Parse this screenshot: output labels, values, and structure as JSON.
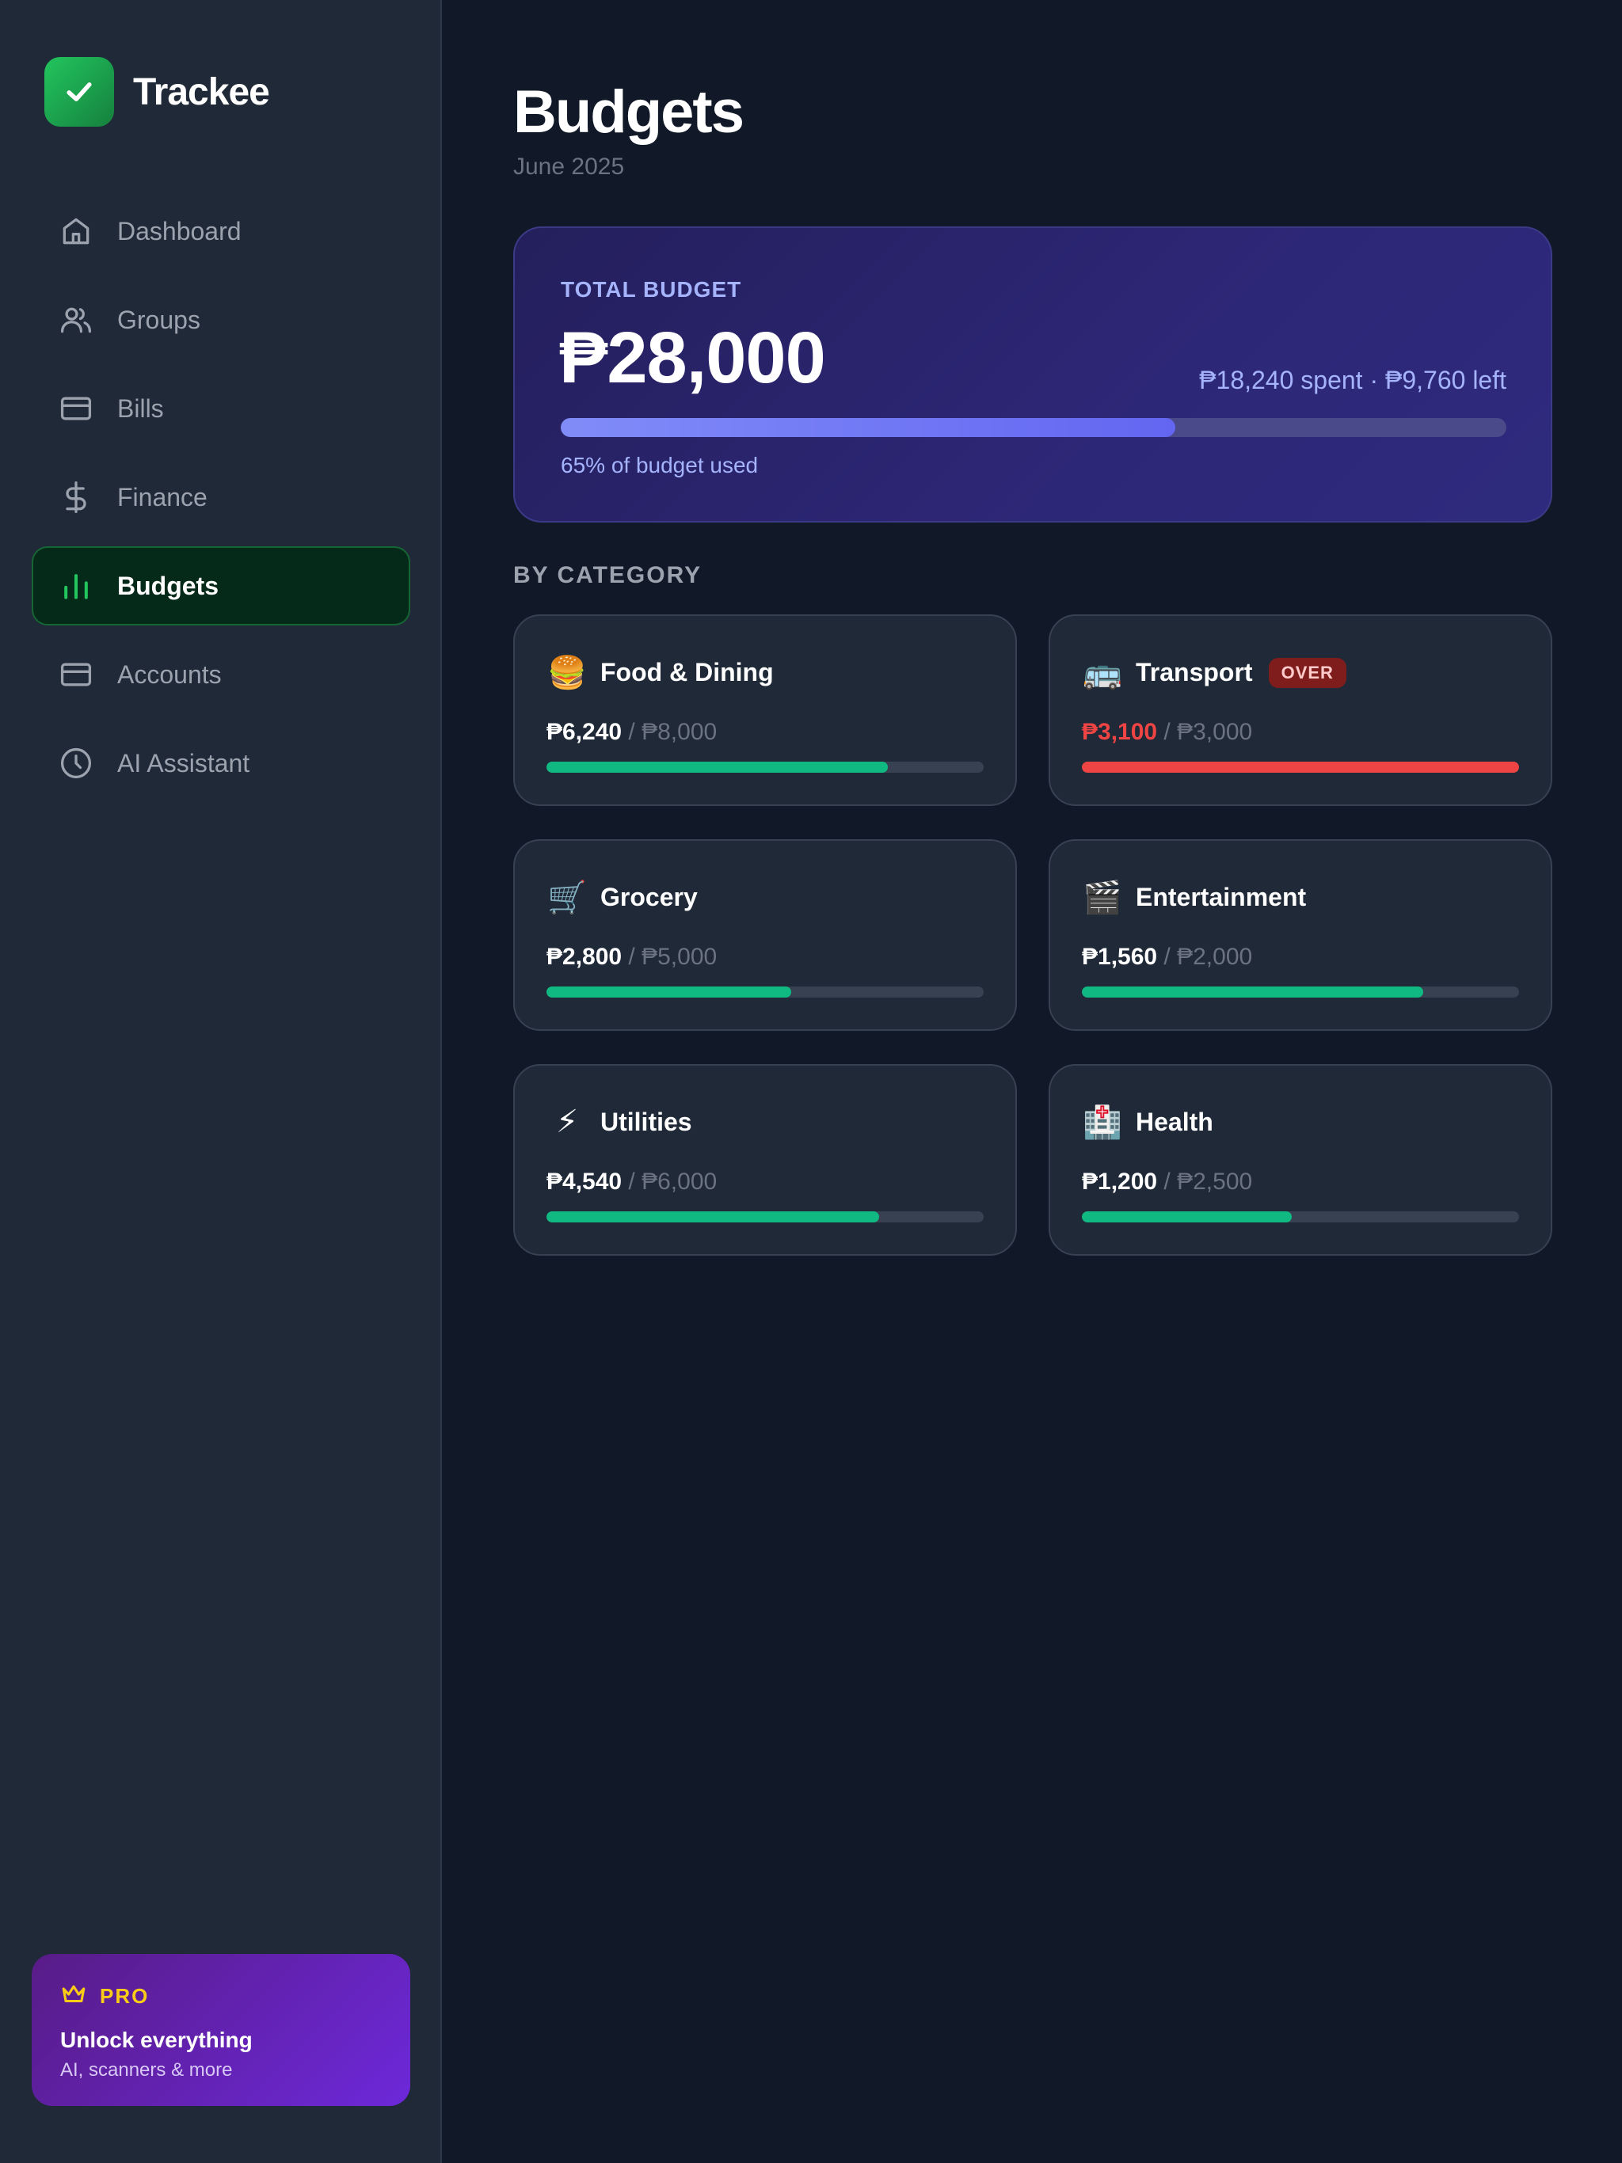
{
  "app": {
    "name": "Trackee"
  },
  "sidebar": {
    "items": [
      {
        "label": "Dashboard",
        "icon": "home-icon",
        "active": false
      },
      {
        "label": "Groups",
        "icon": "users-icon",
        "active": false
      },
      {
        "label": "Bills",
        "icon": "card-icon",
        "active": false
      },
      {
        "label": "Finance",
        "icon": "dollar-icon",
        "active": false
      },
      {
        "label": "Budgets",
        "icon": "bar-chart-icon",
        "active": true
      },
      {
        "label": "Accounts",
        "icon": "card-icon",
        "active": false
      },
      {
        "label": "AI Assistant",
        "icon": "clock-icon",
        "active": false
      }
    ],
    "pro": {
      "badge": "PRO",
      "title": "Unlock everything",
      "subtitle": "AI, scanners & more"
    }
  },
  "header": {
    "title": "Budgets",
    "subtitle": "June 2025"
  },
  "total": {
    "label": "TOTAL BUDGET",
    "amount": "₱28,000",
    "spent_summary": "₱18,240 spent · ₱9,760 left",
    "progress": 0.65,
    "progress_text": "65% of budget used"
  },
  "section_label": "BY CATEGORY",
  "categories": [
    {
      "icon": "🍔",
      "name": "Food & Dining",
      "spent": "₱6,240",
      "separator": " / ",
      "limit": "₱8,000",
      "progress": 0.78,
      "over": false,
      "badge": ""
    },
    {
      "icon": "🚌",
      "name": "Transport",
      "spent": "₱3,100",
      "separator": " / ",
      "limit": "₱3,000",
      "progress": 1.0,
      "over": true,
      "badge": "OVER"
    },
    {
      "icon": "🛒",
      "name": "Grocery",
      "spent": "₱2,800",
      "separator": " / ",
      "limit": "₱5,000",
      "progress": 0.56,
      "over": false,
      "badge": ""
    },
    {
      "icon": "🎬",
      "name": "Entertainment",
      "spent": "₱1,560",
      "separator": " / ",
      "limit": "₱2,000",
      "progress": 0.78,
      "over": false,
      "badge": ""
    },
    {
      "icon": "⚡",
      "name": "Utilities",
      "spent": "₱4,540",
      "separator": " / ",
      "limit": "₱6,000",
      "progress": 0.76,
      "over": false,
      "badge": ""
    },
    {
      "icon": "🏥",
      "name": "Health",
      "spent": "₱1,200",
      "separator": " / ",
      "limit": "₱2,500",
      "progress": 0.48,
      "over": false,
      "badge": ""
    }
  ],
  "colors": {
    "accent": "#22c55e",
    "progress_ok": "#10b981",
    "progress_over": "#ef4444",
    "total_fill": "#818cf8"
  }
}
